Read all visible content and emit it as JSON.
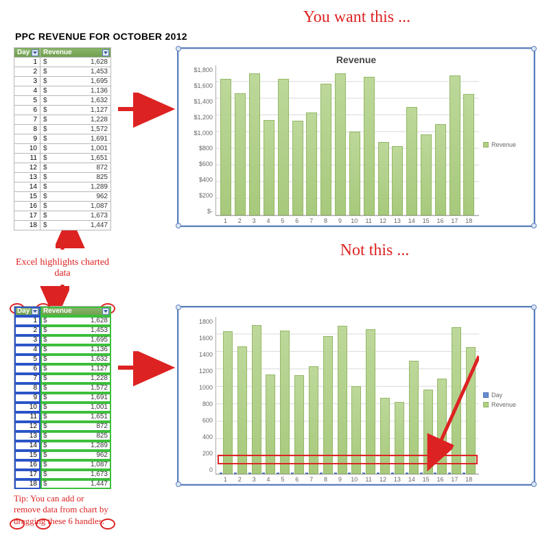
{
  "captions": {
    "want": "You want this ...",
    "not_this": "Not this ...",
    "header": "PPC REVENUE FOR OCTOBER 2012",
    "highlight": "Excel highlights charted data",
    "tip": "Tip: You can add or remove data from chart by dragging these 6 handles."
  },
  "columns": {
    "day": "Day",
    "revenue": "Revenue"
  },
  "currency": "$",
  "rows": [
    {
      "day": 1,
      "rev": "1,628"
    },
    {
      "day": 2,
      "rev": "1,453"
    },
    {
      "day": 3,
      "rev": "1,695"
    },
    {
      "day": 4,
      "rev": "1,136"
    },
    {
      "day": 5,
      "rev": "1,632"
    },
    {
      "day": 6,
      "rev": "1,127"
    },
    {
      "day": 7,
      "rev": "1,228"
    },
    {
      "day": 8,
      "rev": "1,572"
    },
    {
      "day": 9,
      "rev": "1,691"
    },
    {
      "day": 10,
      "rev": "1,001"
    },
    {
      "day": 11,
      "rev": "1,651"
    },
    {
      "day": 12,
      "rev": "872"
    },
    {
      "day": 13,
      "rev": "825"
    },
    {
      "day": 14,
      "rev": "1,289"
    },
    {
      "day": 15,
      "rev": "962"
    },
    {
      "day": 16,
      "rev": "1,087"
    },
    {
      "day": 17,
      "rev": "1,673"
    },
    {
      "day": 18,
      "rev": "1,447"
    }
  ],
  "chart1": {
    "title": "Revenue",
    "yticks": [
      "$1,800",
      "$1,600",
      "$1,400",
      "$1,200",
      "$1,000",
      "$800",
      "$600",
      "$400",
      "$200",
      "$-"
    ],
    "legend": [
      "Revenue"
    ]
  },
  "chart2": {
    "yticks": [
      "1800",
      "1600",
      "1400",
      "1200",
      "1000",
      "800",
      "600",
      "400",
      "200",
      "0"
    ],
    "legend": [
      "Day",
      "Revenue"
    ]
  },
  "chart_data": [
    {
      "type": "bar",
      "title": "Revenue",
      "categories": [
        1,
        2,
        3,
        4,
        5,
        6,
        7,
        8,
        9,
        10,
        11,
        12,
        13,
        14,
        15,
        16,
        17,
        18
      ],
      "values": [
        1628,
        1453,
        1695,
        1136,
        1632,
        1127,
        1228,
        1572,
        1691,
        1001,
        1651,
        872,
        825,
        1289,
        962,
        1087,
        1673,
        1447
      ],
      "xlabel": "",
      "ylabel": "",
      "ylim": [
        0,
        1800
      ],
      "series_name": "Revenue"
    },
    {
      "type": "bar",
      "title": "",
      "categories": [
        1,
        2,
        3,
        4,
        5,
        6,
        7,
        8,
        9,
        10,
        11,
        12,
        13,
        14,
        15,
        16,
        17,
        18
      ],
      "series": [
        {
          "name": "Day",
          "values": [
            1,
            2,
            3,
            4,
            5,
            6,
            7,
            8,
            9,
            10,
            11,
            12,
            13,
            14,
            15,
            16,
            17,
            18
          ]
        },
        {
          "name": "Revenue",
          "values": [
            1628,
            1453,
            1695,
            1136,
            1632,
            1127,
            1228,
            1572,
            1691,
            1001,
            1651,
            872,
            825,
            1289,
            962,
            1087,
            1673,
            1447
          ]
        }
      ],
      "xlabel": "",
      "ylabel": "",
      "ylim": [
        0,
        1800
      ]
    }
  ]
}
